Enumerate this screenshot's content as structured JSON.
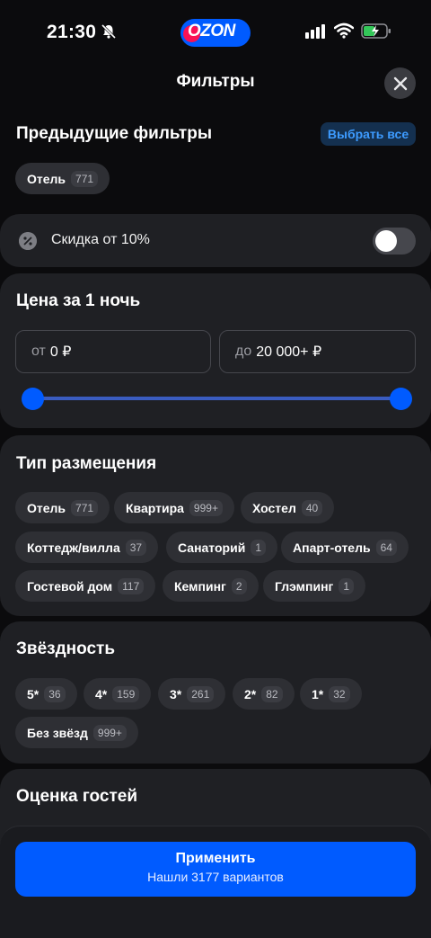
{
  "status_bar": {
    "time": "21:30",
    "brand": "OZON"
  },
  "header": {
    "title": "Фильтры",
    "close_icon": "close-icon"
  },
  "previous_filters": {
    "title": "Предыдущие фильтры",
    "select_all": "Выбрать все",
    "chips": [
      {
        "label": "Отель",
        "count": "771"
      }
    ]
  },
  "discount": {
    "label": "Скидка от 10%",
    "enabled": false
  },
  "price": {
    "title": "Цена за 1 ночь",
    "from_prefix": "от",
    "from_value": "0 ₽",
    "to_prefix": "до",
    "to_value": "20 000+ ₽",
    "range_low_fraction": 0,
    "range_high_fraction": 1
  },
  "accommodation": {
    "title": "Тип размещения",
    "chips": [
      {
        "label": "Отель",
        "count": "771"
      },
      {
        "label": "Квартира",
        "count": "999+"
      },
      {
        "label": "Хостел",
        "count": "40"
      },
      {
        "label": "Коттедж/вилла",
        "count": "37"
      },
      {
        "label": "Санаторий",
        "count": "1"
      },
      {
        "label": "Апарт-отель",
        "count": "64"
      },
      {
        "label": "Гостевой дом",
        "count": "117"
      },
      {
        "label": "Кемпинг",
        "count": "2"
      },
      {
        "label": "Глэмпинг",
        "count": "1"
      }
    ]
  },
  "stars": {
    "title": "Звёздность",
    "chips": [
      {
        "label": "5*",
        "count": "36"
      },
      {
        "label": "4*",
        "count": "159"
      },
      {
        "label": "3*",
        "count": "261"
      },
      {
        "label": "2*",
        "count": "82"
      },
      {
        "label": "1*",
        "count": "32"
      },
      {
        "label": "Без звёзд",
        "count": "999+"
      }
    ]
  },
  "guest_rating": {
    "title": "Оценка гостей"
  },
  "apply": {
    "title": "Применить",
    "subtitle": "Нашли 3177 вариантов"
  },
  "colors": {
    "accent": "#005bff",
    "background": "#0b0b0d",
    "card": "#1f2024",
    "chip": "#2e2f34"
  }
}
